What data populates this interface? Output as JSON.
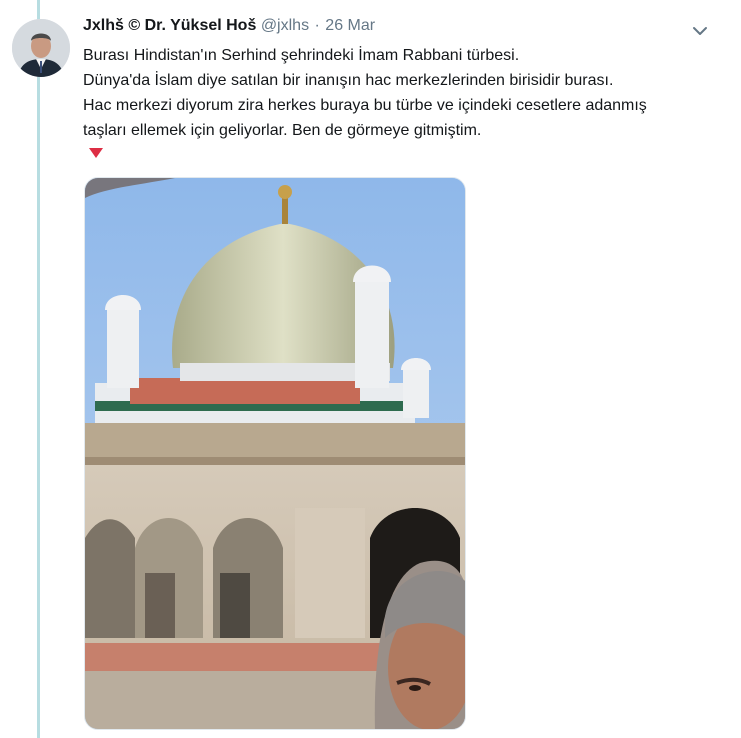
{
  "tweet": {
    "display_name": "Jxlhš © Dr. Yüksel Hoš",
    "username": "@jxlhs",
    "separator": "·",
    "timestamp": "26 Mar",
    "text_lines": [
      "Burası Hindistan'ın Serhind şehrindeki İmam Rabbani türbesi.",
      "Dünya'da İslam diye satılan bir inanışın hac merkezlerinden birisidir burası.",
      "Hac merkezi diyorum zira herkes buraya bu türbe ve içindeki cesetlere adanmış",
      "taşları ellemek için geliyorlar. Ben de görmeye gitmiştim."
    ],
    "emoji": "down-pointing-triangle",
    "caret_icon": "chevron-down-icon"
  },
  "colors": {
    "thread_line": "#b7dde1",
    "name": "#14171a",
    "meta": "#657786",
    "emoji_red": "#dd2e44"
  }
}
